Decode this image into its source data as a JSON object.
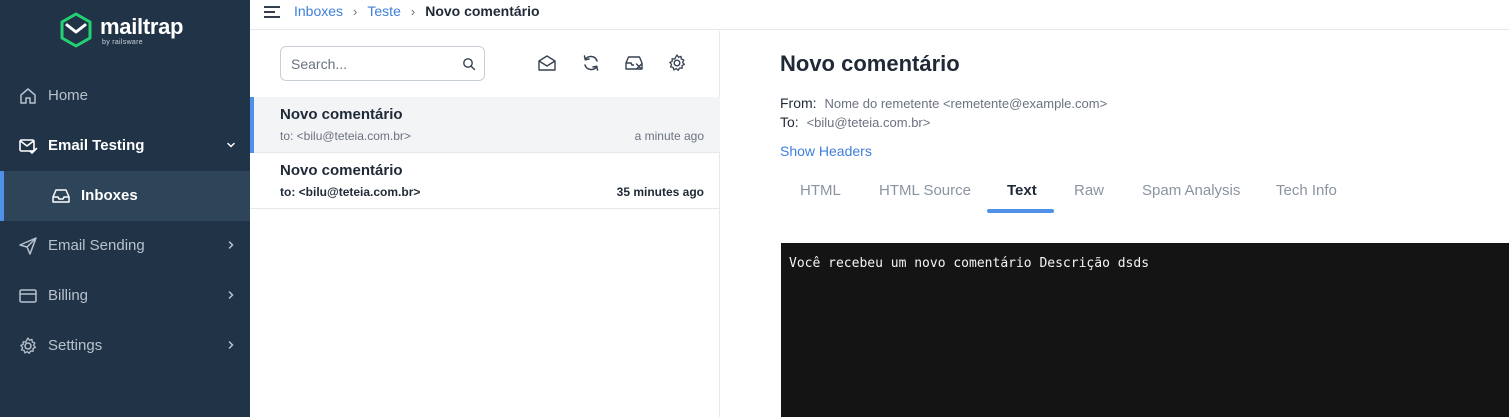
{
  "brand": {
    "name": "mailtrap",
    "tagline": "by railsware"
  },
  "sidebar": {
    "items": [
      {
        "label": "Home",
        "icon": "home-icon"
      },
      {
        "label": "Email Testing",
        "icon": "email-testing-icon",
        "expanded": true
      },
      {
        "label": "Inboxes",
        "icon": "inbox-icon",
        "active": true
      },
      {
        "label": "Email Sending",
        "icon": "send-icon"
      },
      {
        "label": "Billing",
        "icon": "billing-icon"
      },
      {
        "label": "Settings",
        "icon": "gear-icon"
      }
    ]
  },
  "breadcrumb": {
    "items": [
      "Inboxes",
      "Teste"
    ],
    "current": "Novo comentário"
  },
  "list": {
    "search_placeholder": "Search...",
    "toolbar": [
      "mark-read-icon",
      "refresh-icon",
      "clear-inbox-icon",
      "gear-icon"
    ],
    "messages": [
      {
        "subject": "Novo comentário",
        "to": "to: <bilu@teteia.com.br>",
        "time": "a minute ago",
        "selected": true,
        "unread": false
      },
      {
        "subject": "Novo comentário",
        "to": "to: <bilu@teteia.com.br>",
        "time": "35 minutes ago",
        "selected": false,
        "unread": true
      }
    ]
  },
  "detail": {
    "title": "Novo comentário",
    "from_label": "From:",
    "from_value": "Nome do remetente <remetente@example.com>",
    "to_label": "To:",
    "to_value": "<bilu@teteia.com.br>",
    "show_headers": "Show Headers",
    "tabs": [
      "HTML",
      "HTML Source",
      "Text",
      "Raw",
      "Spam Analysis",
      "Tech Info"
    ],
    "active_tab": "Text",
    "body_text": "Você recebeu um novo comentário Descrição dsds"
  },
  "colors": {
    "sidebar_bg": "#213447",
    "accent": "#4f90e8",
    "link": "#3f7fd9",
    "terminal_bg": "#141414",
    "logo_green": "#22d172"
  }
}
